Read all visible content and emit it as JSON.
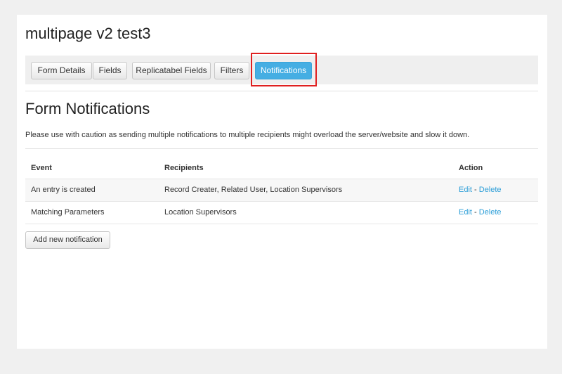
{
  "form": {
    "title": "multipage v2 test3"
  },
  "tabs": [
    {
      "label": "Form Details"
    },
    {
      "label": "Fields"
    },
    {
      "label": "Replicatabel Fields"
    },
    {
      "label": "Filters"
    },
    {
      "label": "Notifications",
      "active": true
    }
  ],
  "section": {
    "title": "Form Notifications",
    "caution": "Please use with caution as sending multiple notifications to multiple recipients might overload the server/website and slow it down."
  },
  "table": {
    "headers": [
      "Event",
      "Recipients",
      "Action"
    ],
    "rows": [
      {
        "event": "An entry is created",
        "recipients": "Record Creater, Related User, Location Supervisors",
        "edit": "Edit",
        "sep": " - ",
        "delete": "Delete"
      },
      {
        "event": "Matching Parameters",
        "recipients": "Location Supervisors",
        "edit": "Edit",
        "sep": " - ",
        "delete": "Delete"
      }
    ]
  },
  "add_button": {
    "label": "Add new notification"
  },
  "colors": {
    "accent": "#45aee3",
    "link": "#2e9fd8",
    "highlight": "#e02020"
  }
}
